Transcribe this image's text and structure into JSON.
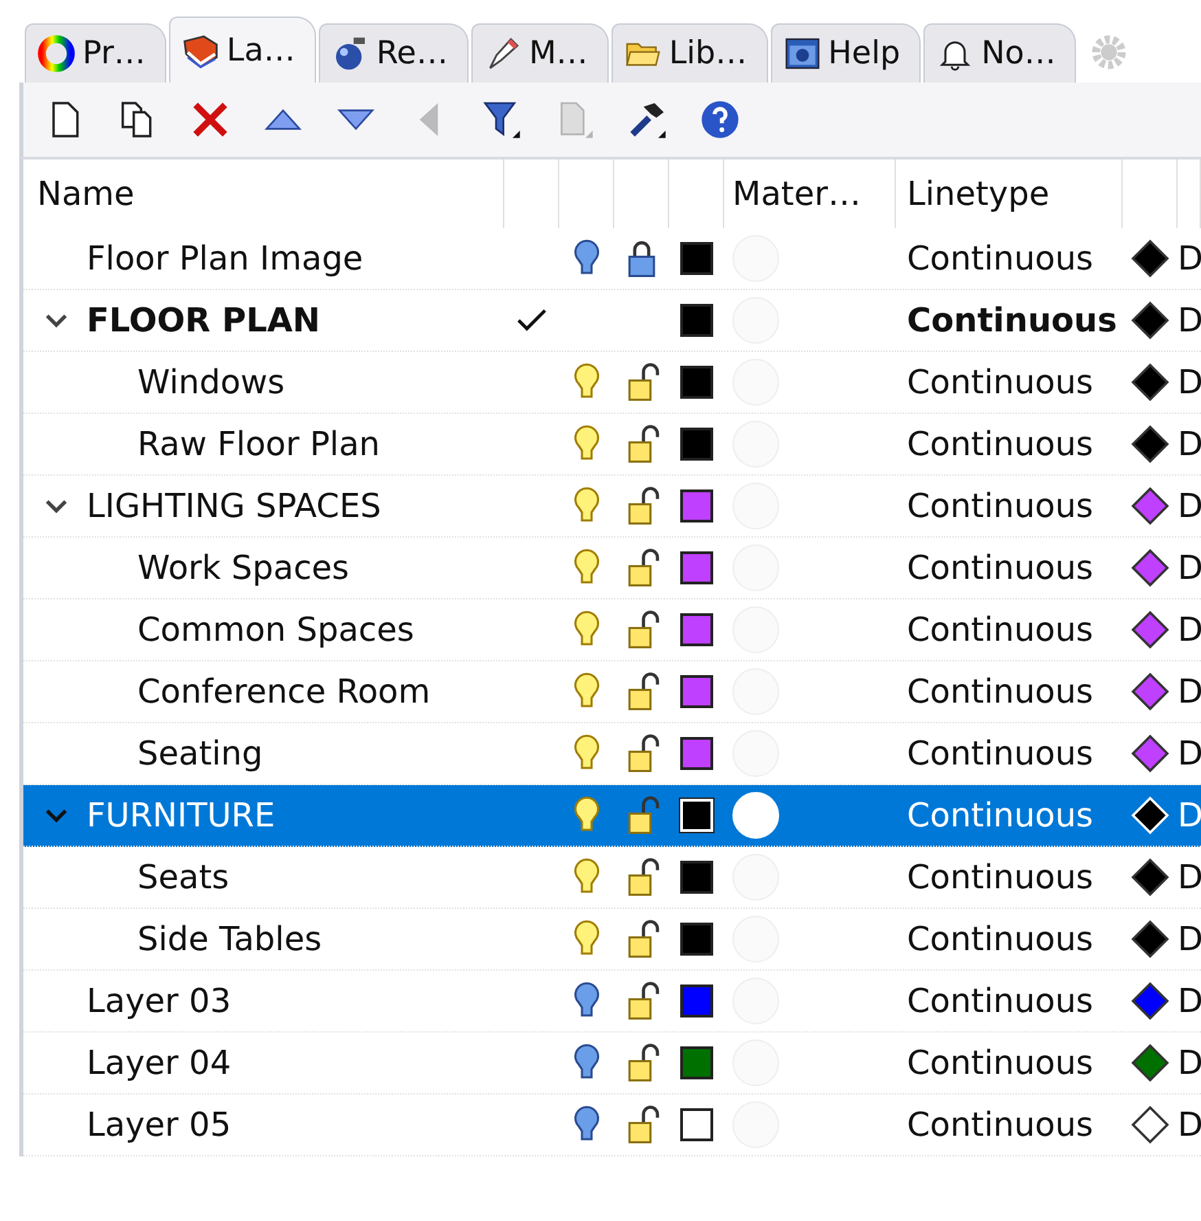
{
  "tabs": [
    {
      "label": "Pr…",
      "kind": "color-wheel",
      "selected": false
    },
    {
      "label": "La…",
      "kind": "layers",
      "selected": true
    },
    {
      "label": "Re…",
      "kind": "teapot",
      "selected": false
    },
    {
      "label": "M…",
      "kind": "brush",
      "selected": false
    },
    {
      "label": "Lib…",
      "kind": "folder",
      "selected": false
    },
    {
      "label": "Help",
      "kind": "help-window",
      "selected": false
    },
    {
      "label": "No…",
      "kind": "bell",
      "selected": false
    }
  ],
  "toolbar": [
    {
      "kind": "new",
      "disabled": false
    },
    {
      "kind": "copy",
      "disabled": false
    },
    {
      "kind": "delete",
      "disabled": false
    },
    {
      "kind": "up",
      "disabled": false
    },
    {
      "kind": "down",
      "disabled": false
    },
    {
      "kind": "left",
      "disabled": true
    },
    {
      "kind": "filter",
      "disabled": false
    },
    {
      "kind": "page",
      "disabled": true
    },
    {
      "kind": "hammer",
      "disabled": false
    },
    {
      "kind": "help",
      "disabled": false
    }
  ],
  "table": {
    "columns": {
      "name": "Name",
      "material": "Mater…",
      "linetype": "Linetype"
    },
    "rows": [
      {
        "name": "Floor Plan Image",
        "current": false,
        "visible": false,
        "locked": true,
        "color": "#000000",
        "linetype": "Continuous",
        "column_9": "D",
        "selected": false
      },
      {
        "name": "FLOOR PLAN",
        "current": true,
        "expanded": true,
        "color": "#000000",
        "linetype": "Continuous",
        "column_9": "D",
        "selected": false,
        "children": [
          {
            "name": "Windows",
            "current": false,
            "visible": true,
            "locked": false,
            "color": "#000000",
            "linetype": "Continuous",
            "column_9": "D",
            "selected": false
          },
          {
            "name": "Raw Floor Plan",
            "current": false,
            "visible": true,
            "locked": false,
            "color": "#000000",
            "linetype": "Continuous",
            "column_9": "D",
            "selected": false
          }
        ]
      },
      {
        "name": "LIGHTING SPACES",
        "current": false,
        "visible": true,
        "locked": false,
        "expanded": true,
        "color": "#bf40ff",
        "linetype": "Continuous",
        "column_9": "D",
        "selected": false,
        "children": [
          {
            "name": "Work Spaces",
            "current": false,
            "visible": true,
            "locked": false,
            "color": "#bf40ff",
            "linetype": "Continuous",
            "column_9": "D",
            "selected": false
          },
          {
            "name": "Common Spaces",
            "current": false,
            "visible": true,
            "locked": false,
            "color": "#bf40ff",
            "linetype": "Continuous",
            "column_9": "D",
            "selected": false
          },
          {
            "name": "Conference Room",
            "current": false,
            "visible": true,
            "locked": false,
            "color": "#bf40ff",
            "linetype": "Continuous",
            "column_9": "D",
            "selected": false
          },
          {
            "name": "Seating",
            "current": false,
            "visible": true,
            "locked": false,
            "color": "#bf40ff",
            "linetype": "Continuous",
            "column_9": "D",
            "selected": false
          }
        ]
      },
      {
        "name": "FURNITURE",
        "current": false,
        "visible": true,
        "locked": false,
        "expanded": true,
        "color": "#000000",
        "linetype": "Continuous",
        "column_9": "D",
        "selected": true,
        "children": [
          {
            "name": "Seats",
            "current": false,
            "visible": true,
            "locked": false,
            "color": "#000000",
            "linetype": "Continuous",
            "column_9": "D",
            "selected": false
          },
          {
            "name": "Side Tables",
            "current": false,
            "visible": true,
            "locked": false,
            "color": "#000000",
            "linetype": "Continuous",
            "column_9": "D",
            "selected": false
          }
        ]
      },
      {
        "name": "Layer 03",
        "current": false,
        "visible": false,
        "locked": false,
        "color": "#0000ff",
        "linetype": "Continuous",
        "column_9": "D",
        "selected": false
      },
      {
        "name": "Layer 04",
        "current": false,
        "visible": false,
        "locked": false,
        "color": "#007000",
        "linetype": "Continuous",
        "column_9": "D",
        "selected": false
      },
      {
        "name": "Layer 05",
        "current": false,
        "visible": false,
        "locked": false,
        "color": "#ffffff",
        "linetype": "Continuous",
        "column_9": "D",
        "selected": false
      }
    ]
  }
}
